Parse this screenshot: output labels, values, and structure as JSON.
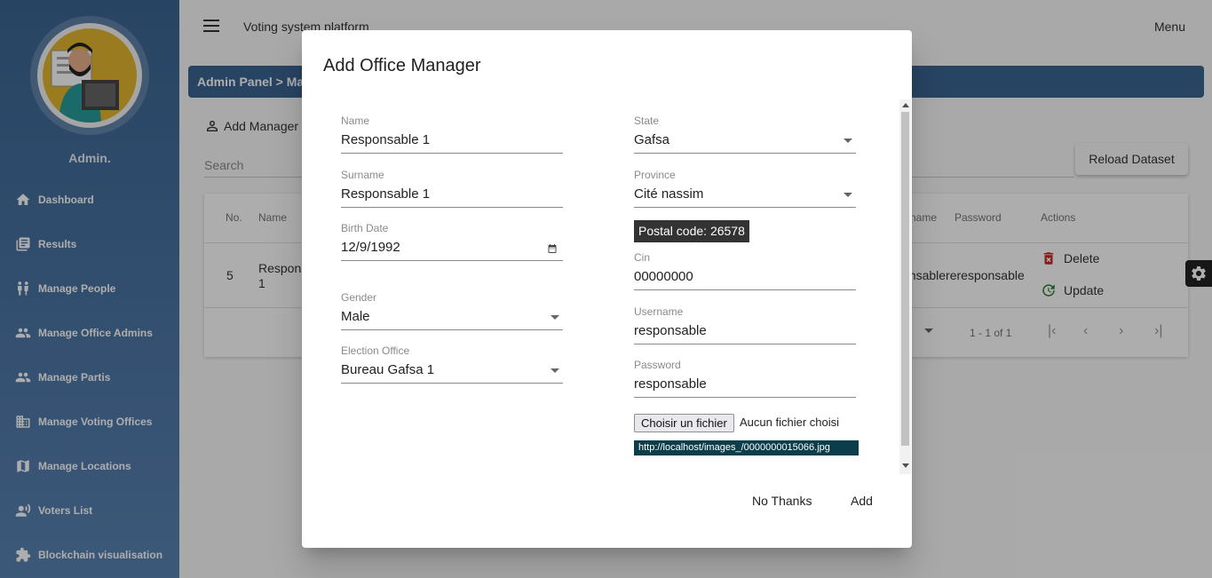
{
  "app": {
    "title": "Voting system platform",
    "menu_label": "Menu"
  },
  "sidebar": {
    "admin_name": "Admin.",
    "items": [
      {
        "label": "Dashboard",
        "icon": "home-icon"
      },
      {
        "label": "Results",
        "icon": "list-icon"
      },
      {
        "label": "Manage People",
        "icon": "people-icon"
      },
      {
        "label": "Manage Office Admins",
        "icon": "group-icon"
      },
      {
        "label": "Manage Partis",
        "icon": "group-icon"
      },
      {
        "label": "Manage Voting Offices",
        "icon": "building-icon"
      },
      {
        "label": "Manage Locations",
        "icon": "map-icon"
      },
      {
        "label": "Voters List",
        "icon": "voice-icon"
      },
      {
        "label": "Blockchain visualisation",
        "icon": "puzzle-icon"
      }
    ]
  },
  "main": {
    "breadcrumb": "Admin Panel > Mar",
    "add_manager_label": "Add Manager",
    "search_placeholder": "Search",
    "reload_label": "Reload Dataset",
    "table": {
      "headers": {
        "no": "No.",
        "name": "Name",
        "username": "name",
        "password": "Password",
        "actions": "Actions"
      },
      "row": {
        "no": "5",
        "name_line1": "Respons",
        "name_line2": "1",
        "credentials": "onsablereresponsable"
      },
      "delete_label": "Delete",
      "update_label": "Update",
      "paging_range": "1 - 1 of 1"
    }
  },
  "dialog": {
    "title": "Add Office Manager",
    "left": {
      "name": {
        "label": "Name",
        "value": "Responsable 1"
      },
      "surname": {
        "label": "Surname",
        "value": "Responsable 1"
      },
      "birth_date": {
        "label": "Birth Date",
        "value": "12/9/1992"
      },
      "gender": {
        "label": "Gender",
        "value": "Male"
      },
      "election_office": {
        "label": "Election Office",
        "value": "Bureau Gafsa 1"
      }
    },
    "right": {
      "state": {
        "label": "State",
        "value": "Gafsa"
      },
      "province": {
        "label": "Province",
        "value": "Cité nassim"
      },
      "postal_code": "Postal code: 26578",
      "cin": {
        "label": "Cin",
        "value": "00000000"
      },
      "username": {
        "label": "Username",
        "value": "responsable"
      },
      "password": {
        "label": "Password",
        "value": "responsable"
      },
      "file_button": "Choisir un fichier",
      "file_status": "Aucun fichier choisi",
      "image_url": "http://localhost/images_/0000000015066.jpg"
    },
    "no_thanks_label": "No Thanks",
    "add_label": "Add"
  },
  "colors": {
    "sidebar": "#3c6593",
    "panel_header": "#3c6593",
    "url_badge": "#0b3d4a"
  }
}
